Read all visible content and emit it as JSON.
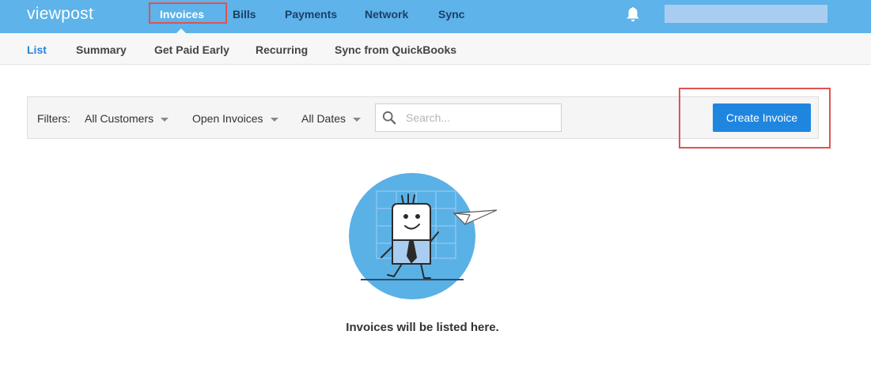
{
  "app": {
    "logo_text": "viewpost",
    "logo_mark": "."
  },
  "topnav": {
    "items": [
      {
        "label": "Invoices",
        "active": true
      },
      {
        "label": "Bills"
      },
      {
        "label": "Payments"
      },
      {
        "label": "Network"
      },
      {
        "label": "Sync"
      }
    ]
  },
  "subnav": {
    "items": [
      {
        "label": "List",
        "active": true
      },
      {
        "label": "Summary"
      },
      {
        "label": "Get Paid Early"
      },
      {
        "label": "Recurring"
      },
      {
        "label": "Sync from QuickBooks"
      }
    ]
  },
  "filters": {
    "label": "Filters:",
    "customers": "All Customers",
    "status": "Open Invoices",
    "dates": "All Dates",
    "search_placeholder": "Search..."
  },
  "actions": {
    "create_invoice": "Create Invoice"
  },
  "empty_state": {
    "message": "Invoices will be listed here."
  },
  "colors": {
    "topbar": "#5db3ea",
    "accent": "#1f86e0",
    "highlight": "#e05252"
  },
  "icons": {
    "notifications": "bell-icon",
    "search": "search-icon"
  }
}
